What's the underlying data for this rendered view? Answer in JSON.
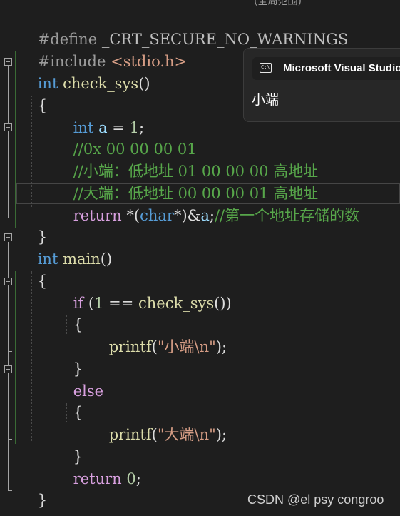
{
  "top_strip": {
    "cut_text": "(全局范围)"
  },
  "code": {
    "l1": {
      "directive": "#define ",
      "macro": "_CRT_SECURE_NO_WARNINGS"
    },
    "l2": {
      "directive": "#include ",
      "header": "<stdio.h>"
    },
    "l3": {
      "type": "int",
      "name": "check_sys",
      "punct": "()"
    },
    "l4": {
      "brace": "{"
    },
    "l5": {
      "type": "int",
      "var": "a",
      "op": " = ",
      "num": "1",
      "end": ";"
    },
    "l6": {
      "comment": "//0x 00 00 00 01"
    },
    "l7": {
      "comment": "//小端：低地址 01 00 00 00 高地址"
    },
    "l8": {
      "comment": "//大端：低地址 00 00 00 01 高地址"
    },
    "l9": {
      "kw": "return",
      "op1": " *(",
      "type": "char",
      "op2": "*)&",
      "var": "a",
      "end": ";",
      "comment": "//第一个地址存储的数"
    },
    "l10": {
      "brace": "}"
    },
    "l11": {
      "type": "int",
      "name": "main",
      "punct": "()"
    },
    "l12": {
      "brace": "{"
    },
    "l13": {
      "kw": "if",
      "p1": " (",
      "num": "1",
      "op": " == ",
      "fn": "check_sys",
      "p2": "())"
    },
    "l14": {
      "brace": "{"
    },
    "l15": {
      "fn": "printf",
      "p1": "(",
      "str": "\"小端\\n\"",
      "p2": ");"
    },
    "l16": {
      "brace": "}"
    },
    "l17": {
      "kw": "else"
    },
    "l18": {
      "brace": "{"
    },
    "l19": {
      "fn": "printf",
      "p1": "(",
      "str": "\"大端\\n\"",
      "p2": ");"
    },
    "l20": {
      "brace": "}"
    },
    "l21": {
      "kw": "return",
      "sp": " ",
      "num": "0",
      "end": ";"
    },
    "l22": {
      "brace": "}"
    }
  },
  "toast": {
    "icon": "console-window-icon",
    "icon_glyph": "C:\\",
    "title": "Microsoft Visual Studio",
    "body": "小端"
  },
  "watermark": "CSDN @el psy congroo",
  "colors": {
    "background": "#1e1e1e",
    "keyword": "#569cd6",
    "control_keyword": "#d8a0df",
    "function": "#dcdcaa",
    "variable": "#9cdcfe",
    "number": "#b5cea8",
    "comment": "#57a64a",
    "string": "#d69d85"
  }
}
